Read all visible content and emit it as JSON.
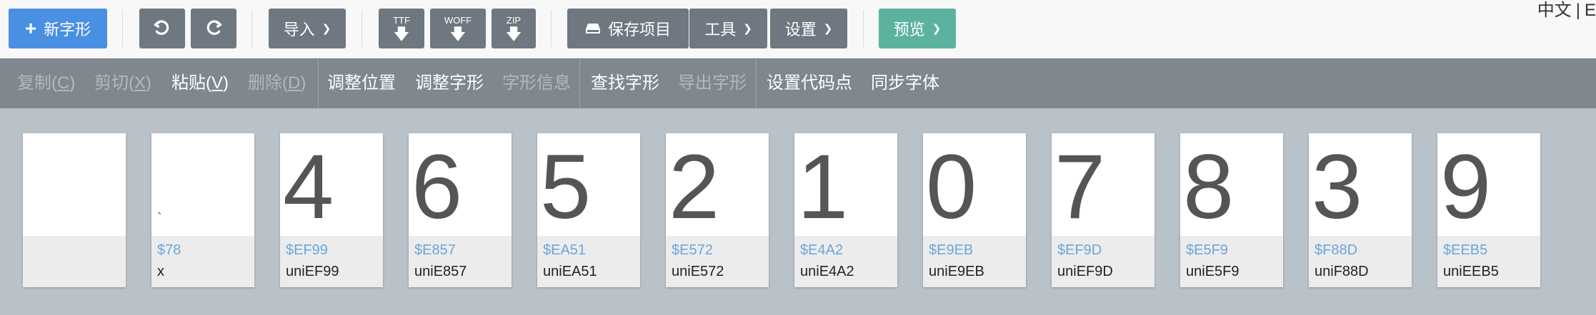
{
  "toolbar": {
    "new_glyph": "新字形",
    "import": "导入",
    "ttf": "TTF",
    "woff": "WOFF",
    "zip": "ZIP",
    "save": "保存项目",
    "tools": "工具",
    "settings": "设置",
    "preview": "预览"
  },
  "language": {
    "zh": "中文",
    "en": "E"
  },
  "actions": {
    "copy": "复制(",
    "copy_key": "C",
    "copy_end": ")",
    "cut": "剪切(",
    "cut_key": "X",
    "cut_end": ")",
    "paste": "粘贴(",
    "paste_key": "V",
    "paste_end": ")",
    "delete": "删除(",
    "delete_key": "D",
    "delete_end": ")",
    "adjust_position": "调整位置",
    "adjust_glyph": "调整字形",
    "glyph_info": "字形信息",
    "find_glyph": "查找字形",
    "export_glyph": "导出字形",
    "set_codepoint": "设置代码点",
    "sync_font": "同步字体"
  },
  "glyphs": [
    {
      "char": "",
      "code": "",
      "name": ""
    },
    {
      "char": "`",
      "code": "$78",
      "name": "x"
    },
    {
      "char": "4",
      "code": "$EF99",
      "name": "uniEF99"
    },
    {
      "char": "6",
      "code": "$E857",
      "name": "uniE857"
    },
    {
      "char": "5",
      "code": "$EA51",
      "name": "uniEA51"
    },
    {
      "char": "2",
      "code": "$E572",
      "name": "uniE572"
    },
    {
      "char": "1",
      "code": "$E4A2",
      "name": "uniE4A2"
    },
    {
      "char": "0",
      "code": "$E9EB",
      "name": "uniE9EB"
    },
    {
      "char": "7",
      "code": "$EF9D",
      "name": "uniEF9D"
    },
    {
      "char": "8",
      "code": "$E5F9",
      "name": "uniE5F9"
    },
    {
      "char": "3",
      "code": "$F88D",
      "name": "uniF88D"
    },
    {
      "char": "9",
      "code": "$EEB5",
      "name": "uniEEB5"
    }
  ]
}
